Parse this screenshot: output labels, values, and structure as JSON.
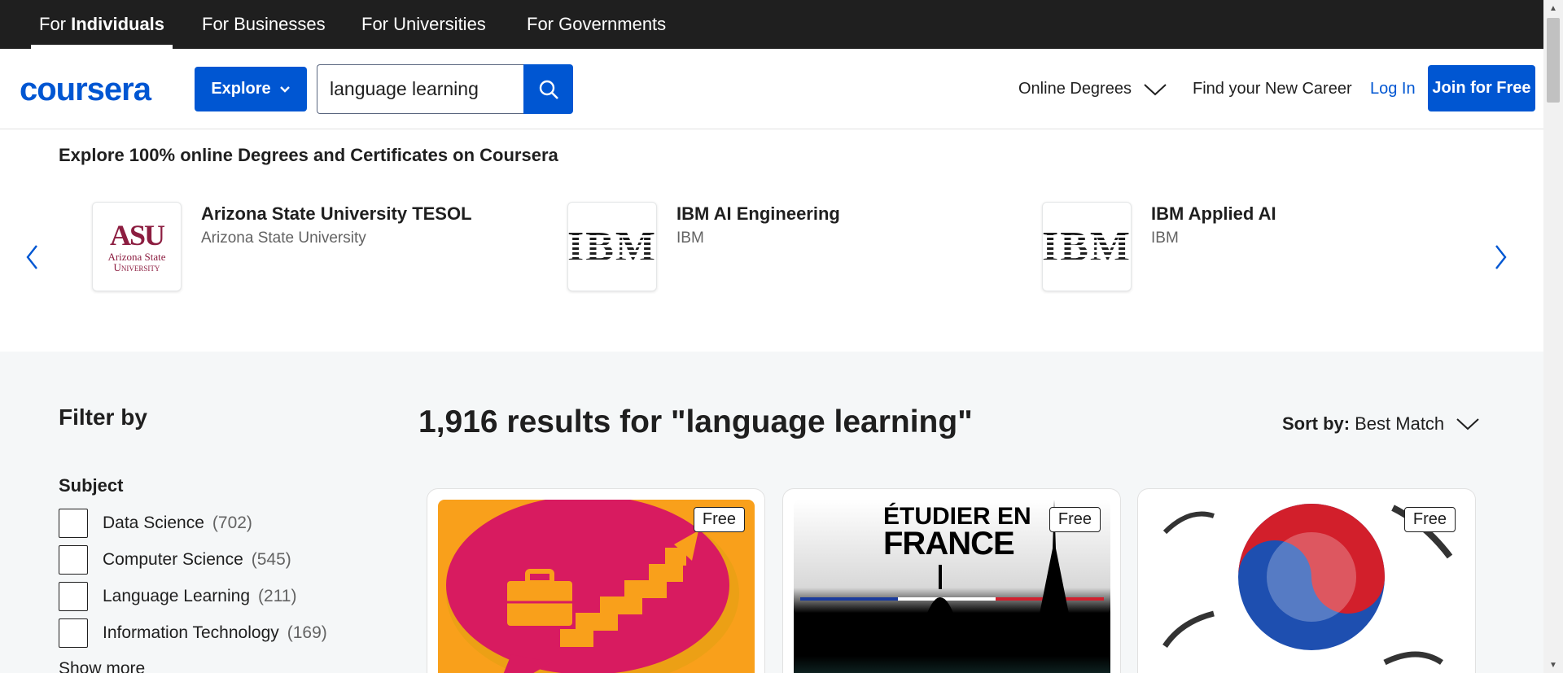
{
  "topbar": {
    "tabs": [
      {
        "prefix": "For ",
        "label": "Individuals",
        "active": true
      },
      {
        "label": "For Businesses"
      },
      {
        "label": "For Universities"
      },
      {
        "label": "For Governments"
      }
    ]
  },
  "header": {
    "logo_text": "coursera",
    "explore_label": "Explore",
    "search_value": "language learning",
    "online_degrees_label": "Online Degrees",
    "find_career_label": "Find your New Career",
    "login_label": "Log In",
    "join_label": "Join for Free",
    "brand_color": "#0056d2"
  },
  "degrees": {
    "title": "Explore 100% online Degrees and Certificates on Coursera",
    "items": [
      {
        "name": "Arizona State University TESOL",
        "partner": "Arizona State University",
        "logo_top": "ASU",
        "logo_bottom_1": "Arizona State",
        "logo_bottom_2": "University"
      },
      {
        "name": "IBM AI Engineering",
        "partner": "IBM",
        "logo": "IBM"
      },
      {
        "name": "IBM Applied AI",
        "partner": "IBM",
        "logo": "IBM"
      }
    ]
  },
  "filters": {
    "title": "Filter by",
    "subject_title": "Subject",
    "items": [
      {
        "label": "Data Science",
        "count": "(702)"
      },
      {
        "label": "Computer Science",
        "count": "(545)"
      },
      {
        "label": "Language Learning",
        "count": "(211)"
      },
      {
        "label": "Information Technology",
        "count": "(169)"
      }
    ],
    "show_more": "Show more"
  },
  "results": {
    "title": "1,916 results for \"language learning\"",
    "sort_label": "Sort by:",
    "sort_value": "Best Match",
    "cards": [
      {
        "badge": "Free"
      },
      {
        "badge": "Free",
        "image_text_1": "ÉTUDIER EN",
        "image_text_2": "FRANCE"
      },
      {
        "badge": "Free"
      }
    ]
  }
}
